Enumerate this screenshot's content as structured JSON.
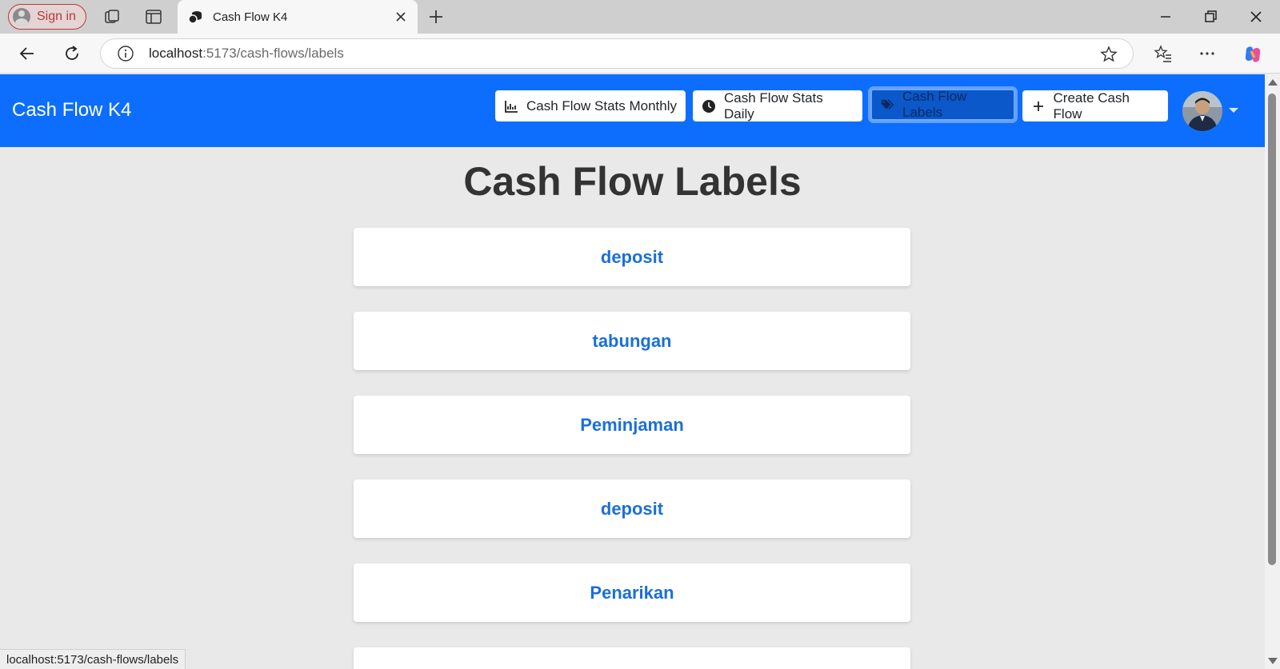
{
  "browser": {
    "signin_label": "Sign in",
    "tab_title": "Cash Flow K4",
    "url_host": "localhost",
    "url_path": ":5173/cash-flows/labels",
    "status_url": "localhost:5173/cash-flows/labels"
  },
  "navbar": {
    "brand": "Cash Flow K4",
    "buttons": [
      {
        "label": "Cash Flow Stats Monthly",
        "icon": "bar-chart-icon"
      },
      {
        "label": "Cash Flow Stats Daily",
        "icon": "clock-icon"
      },
      {
        "label": "Cash Flow Labels",
        "icon": "tags-icon",
        "active": true
      },
      {
        "label": "Create Cash Flow",
        "icon": "plus-icon"
      }
    ],
    "accent_color": "#0d6efd"
  },
  "main": {
    "title": "Cash Flow Labels",
    "labels": [
      "deposit",
      "tabungan",
      "Peminjaman",
      "deposit",
      "Penarikan"
    ]
  }
}
